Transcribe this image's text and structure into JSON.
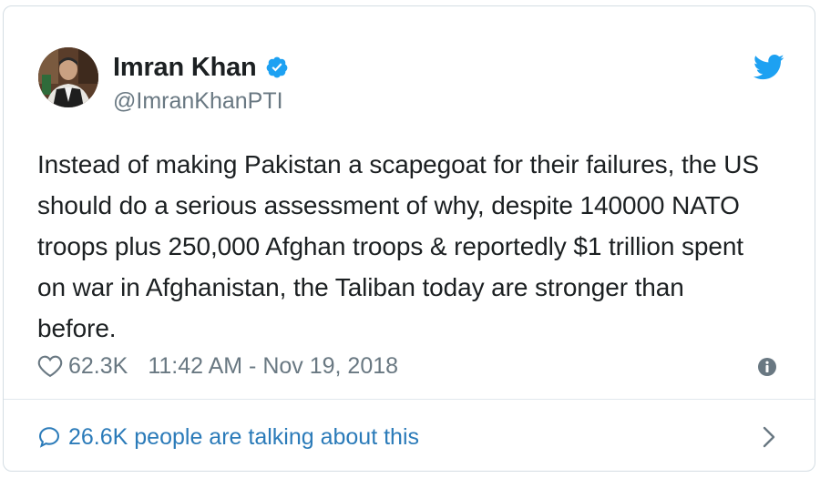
{
  "tweet": {
    "author_name": "Imran Khan",
    "author_handle": "@ImranKhanPTI",
    "text_lines": [
      "Instead of making Pakistan a scapegoat for their failures, the US",
      "should do a serious assessment of why, despite 140000 NATO",
      "troops plus 250,000 Afghan troops & reportedly $1 trillion spent",
      "on war in Afghanistan, the Taliban today are stronger than",
      "before."
    ],
    "likes": "62.3K",
    "timestamp": "11:42 AM - Nov 19, 2018",
    "talking": "26.6K people are talking about this"
  },
  "icons": {
    "verified": "verified-badge-icon",
    "brand": "twitter-bird-icon",
    "like": "heart-icon",
    "info": "info-icon",
    "reply": "speech-bubble-icon",
    "more": "chevron-right-icon"
  },
  "colors": {
    "text": "#1c2022",
    "muted": "#697882",
    "link": "#2b7bb9",
    "brand": "#1da1f2",
    "border": "#d4dde3"
  }
}
